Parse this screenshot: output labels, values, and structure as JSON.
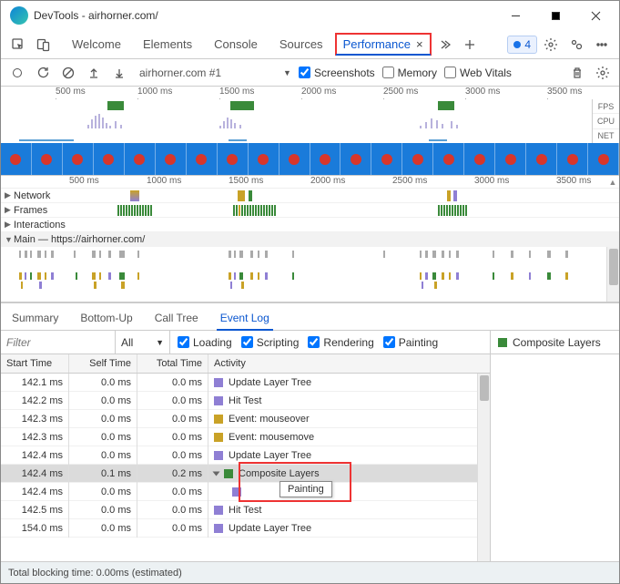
{
  "window": {
    "title": "DevTools - airhorner.com/"
  },
  "tabs": {
    "welcome": "Welcome",
    "elements": "Elements",
    "console": "Console",
    "sources": "Sources",
    "performance": "Performance"
  },
  "badge": {
    "count": "4"
  },
  "toolbar": {
    "recording": "airhorner.com #1",
    "chk_screenshots": "Screenshots",
    "chk_memory": "Memory",
    "chk_webvitals": "Web Vitals"
  },
  "overview_ticks": [
    "500 ms",
    "1000 ms",
    "1500 ms",
    "2000 ms",
    "2500 ms",
    "3000 ms",
    "3500 ms"
  ],
  "ov_labels": {
    "fps": "FPS",
    "cpu": "CPU",
    "net": "NET"
  },
  "main_ticks": [
    "500 ms",
    "1000 ms",
    "1500 ms",
    "2000 ms",
    "2500 ms",
    "3000 ms",
    "3500 ms"
  ],
  "tracks": {
    "network": "Network",
    "frames": "Frames",
    "interactions": "Interactions",
    "main": "Main — https://airhorner.com/"
  },
  "detail_tabs": {
    "summary": "Summary",
    "bottomup": "Bottom-Up",
    "calltree": "Call Tree",
    "eventlog": "Event Log"
  },
  "filter": {
    "placeholder": "Filter",
    "all": "All",
    "loading": "Loading",
    "scripting": "Scripting",
    "rendering": "Rendering",
    "painting": "Painting"
  },
  "side_legend": "Composite Layers",
  "table": {
    "headers": {
      "start": "Start Time",
      "self": "Self Time",
      "total": "Total Time",
      "activity": "Activity"
    },
    "rows": [
      {
        "start": "142.1 ms",
        "self": "0.0 ms",
        "total": "0.0 ms",
        "activity": "Update Layer Tree",
        "color": "sq-p",
        "indent": 0
      },
      {
        "start": "142.2 ms",
        "self": "0.0 ms",
        "total": "0.0 ms",
        "activity": "Hit Test",
        "color": "sq-p",
        "indent": 0
      },
      {
        "start": "142.3 ms",
        "self": "0.0 ms",
        "total": "0.0 ms",
        "activity": "Event: mouseover",
        "color": "sq-y",
        "indent": 0
      },
      {
        "start": "142.3 ms",
        "self": "0.0 ms",
        "total": "0.0 ms",
        "activity": "Event: mousemove",
        "color": "sq-y",
        "indent": 0
      },
      {
        "start": "142.4 ms",
        "self": "0.0 ms",
        "total": "0.0 ms",
        "activity": "Update Layer Tree",
        "color": "sq-p",
        "indent": 0
      },
      {
        "start": "142.4 ms",
        "self": "0.1 ms",
        "total": "0.2 ms",
        "activity": "Composite Layers",
        "color": "sq-g",
        "indent": 0,
        "sel": true,
        "disc": true
      },
      {
        "start": "142.4 ms",
        "self": "0.0 ms",
        "total": "0.0 ms",
        "activity": "",
        "color": "sq-p",
        "indent": 1
      },
      {
        "start": "142.5 ms",
        "self": "0.0 ms",
        "total": "0.0 ms",
        "activity": "Hit Test",
        "color": "sq-p",
        "indent": 0
      },
      {
        "start": "154.0 ms",
        "self": "0.0 ms",
        "total": "0.0 ms",
        "activity": "Update Layer Tree",
        "color": "sq-p",
        "indent": 0
      }
    ]
  },
  "tooltip": "Painting",
  "status": "Total blocking time: 0.00ms (estimated)"
}
